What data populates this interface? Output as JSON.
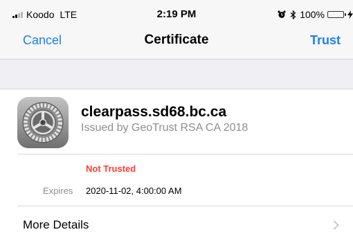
{
  "status_bar": {
    "carrier": "Koodo",
    "network": "LTE",
    "time": "2:19 PM",
    "battery_percent": "100%",
    "battery_level": 1.0
  },
  "nav": {
    "cancel_label": "Cancel",
    "title": "Certificate",
    "trust_label": "Trust"
  },
  "certificate": {
    "host": "clearpass.sd68.bc.ca",
    "issuer": "Issued by GeoTrust RSA CA 2018",
    "trust_status": "Not Trusted",
    "expires_label": "Expires",
    "expires_value": "2020-11-02, 4:00:00 AM"
  },
  "more_details": {
    "label": "More Details"
  },
  "colors": {
    "accent": "#1d7ff5",
    "warning": "#ff3b30",
    "battery": "#4cd964"
  }
}
